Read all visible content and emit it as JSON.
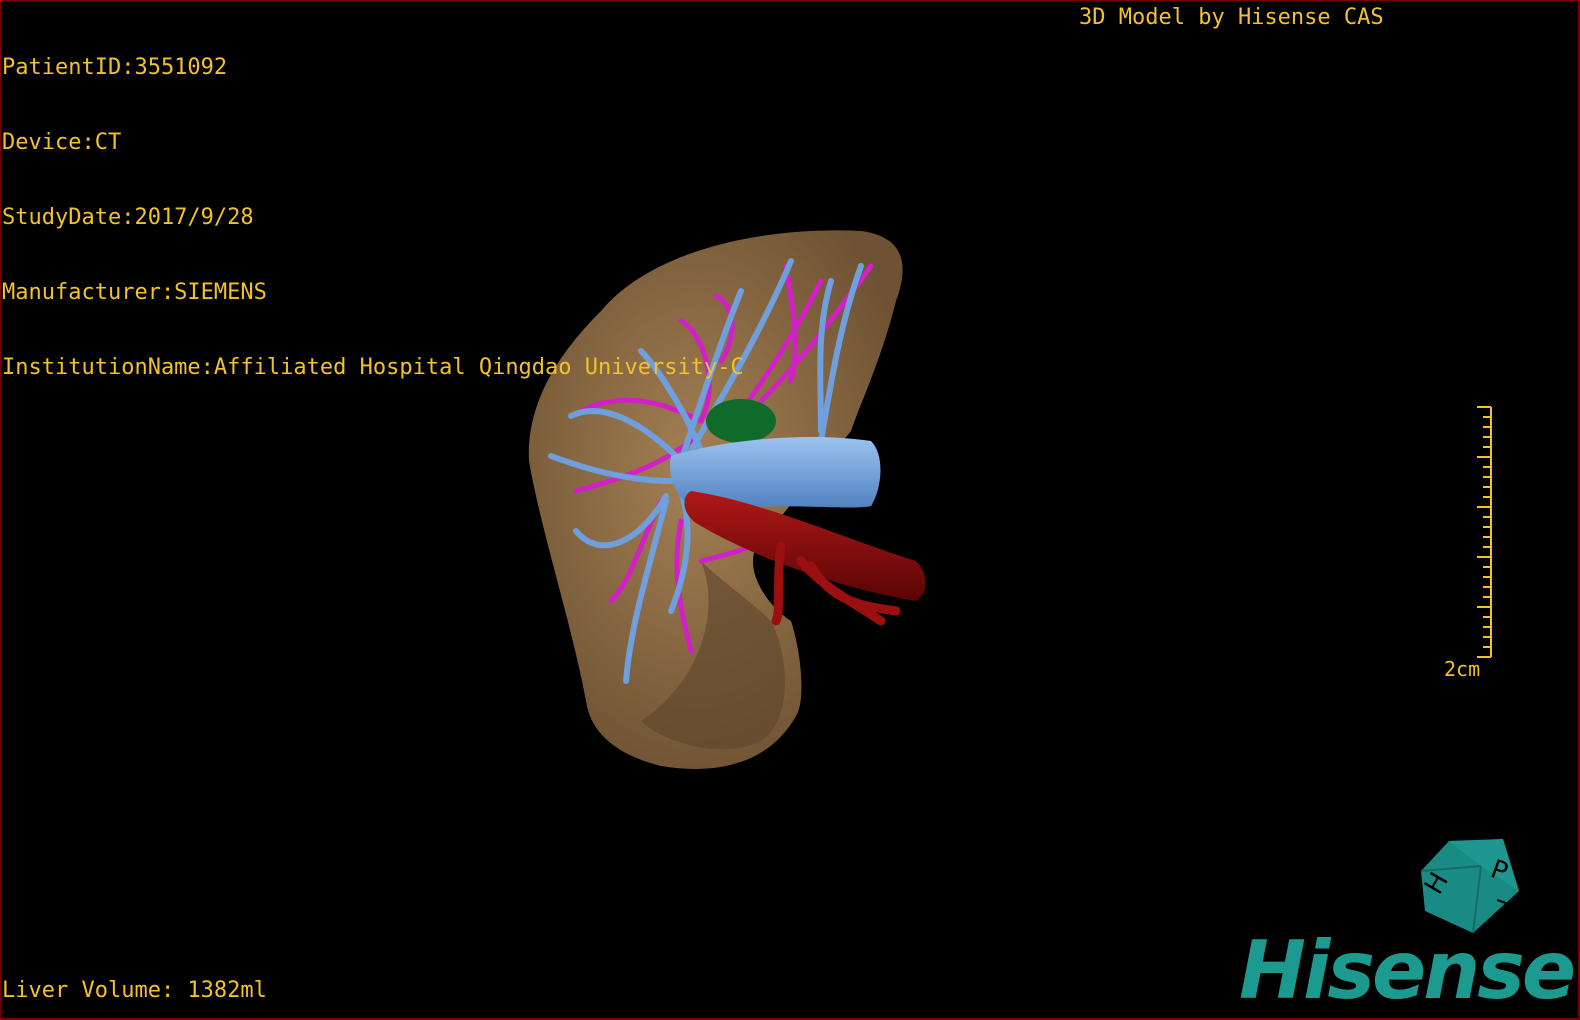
{
  "header": {
    "patient_id": "PatientID:3551092",
    "device": "Device:CT",
    "study_date": "StudyDate:2017/9/28",
    "manufacturer": "Manufacturer:SIEMENS",
    "institution": "InstitutionName:Affiliated Hospital Qingdao University-C",
    "brand_title": "3D Model by Hisense CAS"
  },
  "footer": {
    "liver_volume": "Liver Volume: 1382ml"
  },
  "scale_bar": {
    "label": "2cm"
  },
  "orientation_cube": {
    "faces": [
      "P",
      "H",
      "7"
    ],
    "color": "#1a8a84"
  },
  "logo": {
    "text": "Hisense",
    "color": "#1d9a8f"
  },
  "colors": {
    "overlay_text": "#f2c12e",
    "liver": "#8c6a43",
    "portal_vein": "#6f9fdc",
    "hepatic_vein": "#d21fc8",
    "artery": "#8b0a0a",
    "tumor": "#0f6b2a"
  }
}
